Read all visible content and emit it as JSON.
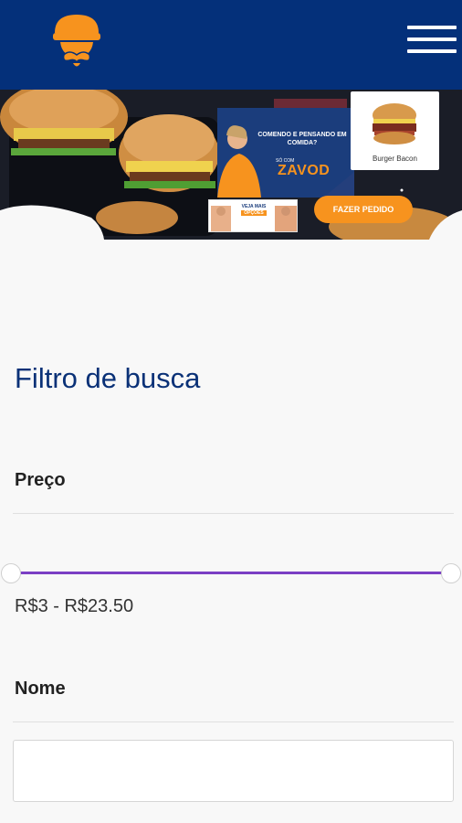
{
  "header": {
    "logo_icon": "mustache-burger-logo",
    "menu_icon": "hamburger-menu-icon",
    "background_color": "#04307a"
  },
  "hero": {
    "promo_headline": "COMENDO E PENSANDO EM COMIDA?",
    "promo_subline": "SÓ COM",
    "promo_brand": "ZAVOD",
    "product_card_label": "Burger Bacon",
    "veja_label": "VEJA MAIS",
    "veja_tag": "OPÇÕES",
    "order_button": "FAZER PEDIDO",
    "accent_color": "#f7931e"
  },
  "filter": {
    "title": "Filtro de busca",
    "price": {
      "label": "Preço",
      "range_text": "R$3 - R$23.50",
      "min": 3,
      "max": 23.5,
      "slider_color": "#7b3fc4"
    },
    "name": {
      "label": "Nome",
      "value": "",
      "placeholder": ""
    }
  }
}
